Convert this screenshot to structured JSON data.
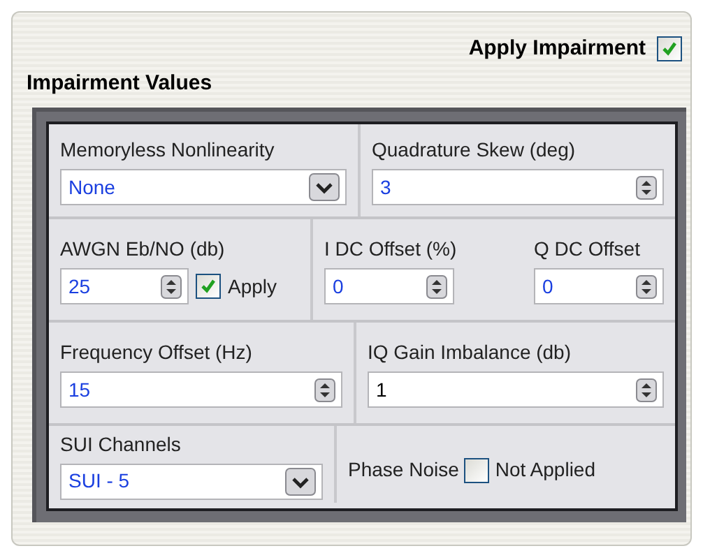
{
  "apply_impairment": {
    "label": "Apply Impairment",
    "checked": true
  },
  "group_title": "Impairment Values",
  "rows": [
    {
      "sections": [
        [
          {
            "kind": "dropdown",
            "label": "Memoryless Nonlinearity",
            "value": "None",
            "color": "#1a3fe0"
          }
        ],
        [
          {
            "kind": "spinner",
            "label": "Quadrature Skew (deg)",
            "value": "3",
            "color": "#1a3fe0"
          }
        ]
      ]
    },
    {
      "sections": [
        [
          {
            "kind": "spinner",
            "label": "AWGN Eb/NO (db)",
            "value": "25",
            "color": "#1a3fe0",
            "apply": {
              "label": "Apply",
              "checked": true
            }
          }
        ],
        [
          {
            "kind": "spinner",
            "label": "I DC Offset (%)",
            "value": "0",
            "color": "#1a3fe0"
          },
          {
            "kind": "spinner",
            "label": "Q DC Offset",
            "value": "0",
            "color": "#1a3fe0"
          }
        ]
      ]
    },
    {
      "sections": [
        [
          {
            "kind": "spinner",
            "label": "Frequency Offset (Hz)",
            "value": "15",
            "color": "#1a3fe0"
          }
        ],
        [
          {
            "kind": "spinner",
            "label": "IQ Gain Imbalance (db)",
            "value": "1",
            "color": "#000000"
          }
        ]
      ]
    },
    {
      "sections": [
        [
          {
            "kind": "dropdown",
            "label": "SUI Channels",
            "value": "SUI - 5",
            "color": "#1a3fe0"
          }
        ],
        [
          {
            "kind": "checkbox",
            "label": "Phase Noise",
            "box_label": "Not Applied",
            "checked": false
          }
        ]
      ]
    }
  ]
}
